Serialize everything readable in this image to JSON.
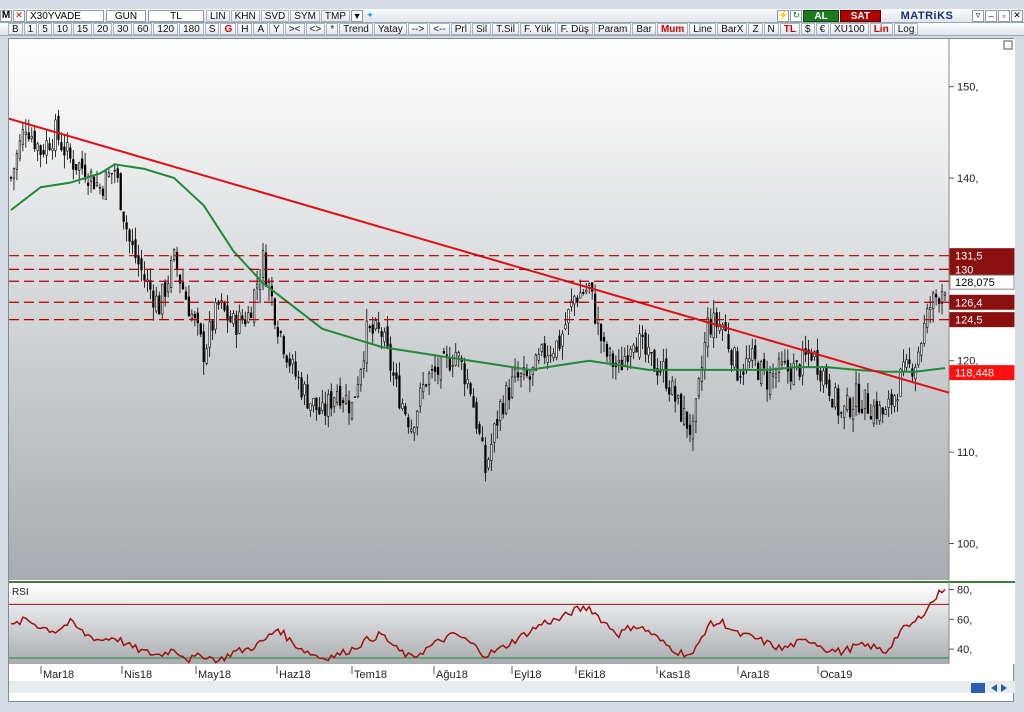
{
  "toolbar": {
    "letter": "M",
    "symbol": "X30YVADE",
    "period": "GUN",
    "currency": "TL",
    "buttons1": [
      "LIN",
      "KHN",
      "SVD",
      "SYM",
      "TMP"
    ],
    "al": "AL",
    "sat": "SAT",
    "logo": "MATRiKS",
    "buttons2": [
      "B",
      "1",
      "5",
      "10",
      "15",
      "20",
      "30",
      "60",
      "120",
      "180",
      "S",
      "G",
      "H",
      "A",
      "Y",
      "><",
      "<>",
      "*",
      "Trend",
      "Yatay",
      "-->",
      "<--",
      "Prl",
      "Sil",
      "T.Sil",
      "F. Yük",
      "F. Düş",
      "Param",
      "Bar",
      "Mum",
      "Line",
      "BarX",
      "Z",
      "N",
      "TL",
      "$",
      "€",
      "XU100",
      "Lin",
      "Log"
    ],
    "active2": [
      "G",
      "Mum",
      "TL",
      "Lin"
    ]
  },
  "chart_data": {
    "type": "candlestick",
    "instrument": "X30YVADE",
    "main_ylim": [
      96,
      155
    ],
    "main_yticks": [
      100,
      110,
      120,
      140,
      150
    ],
    "x_labels": [
      "Mar18",
      "Nis18",
      "May18",
      "Haz18",
      "Tem18",
      "Ağu18",
      "Eyl18",
      "Eki18",
      "Kas18",
      "Ara18",
      "Oca19"
    ],
    "close_path": [
      [
        0,
        140
      ],
      [
        5,
        146
      ],
      [
        10,
        143
      ],
      [
        15,
        145
      ],
      [
        20,
        142
      ],
      [
        25,
        141
      ],
      [
        30,
        139
      ],
      [
        35,
        141
      ],
      [
        40,
        133
      ],
      [
        45,
        129
      ],
      [
        50,
        126
      ],
      [
        55,
        131
      ],
      [
        60,
        126
      ],
      [
        65,
        121
      ],
      [
        70,
        126
      ],
      [
        75,
        124
      ],
      [
        80,
        125
      ],
      [
        85,
        131
      ],
      [
        90,
        124
      ],
      [
        95,
        119
      ],
      [
        100,
        116
      ],
      [
        105,
        114
      ],
      [
        110,
        117
      ],
      [
        115,
        115
      ],
      [
        120,
        123
      ],
      [
        125,
        123
      ],
      [
        130,
        117
      ],
      [
        135,
        113
      ],
      [
        140,
        118
      ],
      [
        145,
        119
      ],
      [
        150,
        121
      ],
      [
        155,
        117
      ],
      [
        160,
        108
      ],
      [
        165,
        115
      ],
      [
        170,
        118
      ],
      [
        175,
        118
      ],
      [
        180,
        121
      ],
      [
        185,
        122
      ],
      [
        190,
        127
      ],
      [
        195,
        128
      ],
      [
        200,
        121
      ],
      [
        205,
        119
      ],
      [
        210,
        123
      ],
      [
        215,
        120
      ],
      [
        220,
        119
      ],
      [
        225,
        115
      ],
      [
        230,
        112
      ],
      [
        235,
        124
      ],
      [
        240,
        124
      ],
      [
        245,
        119
      ],
      [
        250,
        120
      ],
      [
        255,
        118
      ],
      [
        260,
        119
      ],
      [
        265,
        119
      ],
      [
        270,
        121
      ],
      [
        275,
        118
      ],
      [
        280,
        114
      ],
      [
        285,
        116
      ],
      [
        290,
        115
      ],
      [
        295,
        114
      ],
      [
        300,
        118
      ],
      [
        305,
        120
      ],
      [
        310,
        126
      ],
      [
        315,
        128.5
      ]
    ],
    "ma_path": [
      [
        0,
        136.5
      ],
      [
        10,
        139
      ],
      [
        20,
        139.5
      ],
      [
        30,
        140.5
      ],
      [
        35,
        141.5
      ],
      [
        45,
        141
      ],
      [
        55,
        140
      ],
      [
        65,
        137
      ],
      [
        75,
        132
      ],
      [
        85,
        128.5
      ],
      [
        95,
        126
      ],
      [
        105,
        123.5
      ],
      [
        115,
        122.5
      ],
      [
        125,
        121.5
      ],
      [
        135,
        121
      ],
      [
        145,
        120.5
      ],
      [
        155,
        120
      ],
      [
        165,
        119.5
      ],
      [
        175,
        119
      ],
      [
        185,
        119.5
      ],
      [
        195,
        120
      ],
      [
        205,
        119.5
      ],
      [
        215,
        119
      ],
      [
        225,
        119
      ],
      [
        235,
        119
      ],
      [
        245,
        119
      ],
      [
        255,
        119
      ],
      [
        265,
        119.3
      ],
      [
        275,
        119.3
      ],
      [
        285,
        119
      ],
      [
        295,
        118.8
      ],
      [
        305,
        118.8
      ],
      [
        310,
        119
      ],
      [
        315,
        119.2
      ]
    ],
    "trendline": {
      "start_price": 146.5,
      "end_price": 116.5
    },
    "horizontal_lines": [
      131.5,
      130,
      128.7,
      126.4,
      124.5
    ],
    "price_labels": [
      {
        "text": "131,5",
        "style": "dark"
      },
      {
        "text": "130",
        "style": "dark"
      },
      {
        "text": "128,075",
        "style": "white"
      },
      {
        "text": "126,4",
        "style": "dark"
      },
      {
        "text": "124,5",
        "style": "dark"
      },
      {
        "text": "118,448",
        "style": "red"
      }
    ],
    "rsi": {
      "label": "RSI",
      "ylim": [
        30,
        83
      ],
      "yticks": [
        40,
        60,
        80
      ],
      "overbought": 70,
      "oversold": 30,
      "path": [
        [
          0,
          55
        ],
        [
          5,
          60
        ],
        [
          10,
          55
        ],
        [
          15,
          52
        ],
        [
          20,
          58
        ],
        [
          25,
          50
        ],
        [
          30,
          46
        ],
        [
          35,
          48
        ],
        [
          40,
          42
        ],
        [
          45,
          38
        ],
        [
          50,
          36
        ],
        [
          55,
          40
        ],
        [
          60,
          33
        ],
        [
          65,
          36
        ],
        [
          70,
          32
        ],
        [
          75,
          38
        ],
        [
          80,
          40
        ],
        [
          85,
          45
        ],
        [
          90,
          54
        ],
        [
          95,
          44
        ],
        [
          100,
          38
        ],
        [
          105,
          34
        ],
        [
          110,
          36
        ],
        [
          115,
          40
        ],
        [
          120,
          46
        ],
        [
          125,
          50
        ],
        [
          130,
          40
        ],
        [
          135,
          34
        ],
        [
          140,
          40
        ],
        [
          145,
          46
        ],
        [
          150,
          50
        ],
        [
          155,
          44
        ],
        [
          160,
          36
        ],
        [
          165,
          40
        ],
        [
          170,
          46
        ],
        [
          175,
          52
        ],
        [
          180,
          58
        ],
        [
          185,
          60
        ],
        [
          190,
          66
        ],
        [
          195,
          68
        ],
        [
          200,
          58
        ],
        [
          205,
          50
        ],
        [
          210,
          56
        ],
        [
          215,
          52
        ],
        [
          220,
          44
        ],
        [
          225,
          38
        ],
        [
          230,
          36
        ],
        [
          235,
          56
        ],
        [
          240,
          58
        ],
        [
          245,
          50
        ],
        [
          250,
          48
        ],
        [
          255,
          44
        ],
        [
          260,
          40
        ],
        [
          265,
          44
        ],
        [
          270,
          46
        ],
        [
          275,
          40
        ],
        [
          280,
          38
        ],
        [
          285,
          42
        ],
        [
          290,
          42
        ],
        [
          295,
          38
        ],
        [
          300,
          52
        ],
        [
          305,
          58
        ],
        [
          310,
          70
        ],
        [
          315,
          82
        ]
      ]
    }
  }
}
